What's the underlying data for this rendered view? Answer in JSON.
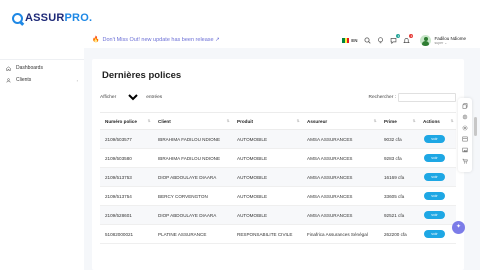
{
  "brand": {
    "name_main": "ASSUR",
    "name_accent": "PRO."
  },
  "announcement": {
    "icon": "fire-icon",
    "text": "Don't Miss Out! new update has been release ↗"
  },
  "header": {
    "lang": "EN",
    "flag_colors": [
      "#00853f",
      "#fdef42",
      "#e31b23"
    ],
    "badges": {
      "notifications": "2",
      "messages": "1"
    },
    "user_name": "Fadilou Ndiome",
    "user_role": "super"
  },
  "sidebar": {
    "items": [
      {
        "label": "Dashboards",
        "icon": "home-icon"
      },
      {
        "label": "Clients",
        "icon": "users-icon"
      }
    ]
  },
  "page": {
    "title": "Dernières polices",
    "show_label": "Afficher",
    "show_value": "10",
    "show_suffix": "entrées",
    "search_label": "Rechercher :"
  },
  "table": {
    "columns": [
      "Numéro police",
      "Client",
      "Produit",
      "Assureur",
      "Prime",
      "Actions"
    ],
    "rows": [
      [
        "2109/503577",
        "IBRAHIMA FADILOU NDIONE",
        "AUTOMOBILE",
        "AMSA ASSURANCES",
        "9032 cfa",
        "voir"
      ],
      [
        "2109/503580",
        "IBRAHIMA FADILOU NDIONE",
        "AUTOMOBILE",
        "AMSA ASSURANCES",
        "9283 cfa",
        "voir"
      ],
      [
        "2109/513753",
        "DIOP ABDOULAYE DIAARA",
        "AUTOMOBILE",
        "AMSA ASSURANCES",
        "16169 cfa",
        "voir"
      ],
      [
        "2109/513754",
        "BERCY CORVENGTON",
        "AUTOMOBILE",
        "AMSA ASSURANCES",
        "33605 cfa",
        "voir"
      ],
      [
        "2109/528601",
        "DIOP ABDOULAYE DIAARA",
        "AUTOMOBILE",
        "AMSA ASSURANCES",
        "92521 cfa",
        "voir"
      ],
      [
        "51082000021",
        "PLATINE ASSURANCE",
        "RESPONSABILITE CIVILE",
        "Finafrica Assurances Sénégal",
        "262200 cfa",
        "voir"
      ]
    ]
  },
  "colors": {
    "accent": "#1ea7e4",
    "brand_dark": "#1e2a78",
    "fab": "#7c7ce8"
  }
}
